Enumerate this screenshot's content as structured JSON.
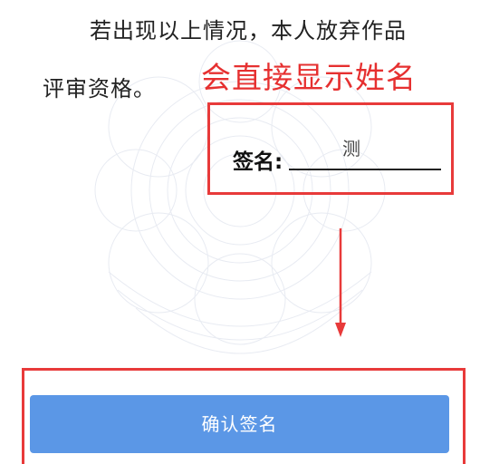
{
  "declaration": {
    "line1": "若出现以上情况，本人放弃作品",
    "line2": "评审资格。"
  },
  "annotation": {
    "text": "会直接显示姓名",
    "color": "#e63030"
  },
  "signature": {
    "label": "签名:",
    "value": "测"
  },
  "confirm_button": {
    "label": "确认签名",
    "color": "#5b97e6"
  },
  "highlight_color": "#e83a3a",
  "icons": [
    "arrow-down-icon",
    "watermark-emblem"
  ]
}
